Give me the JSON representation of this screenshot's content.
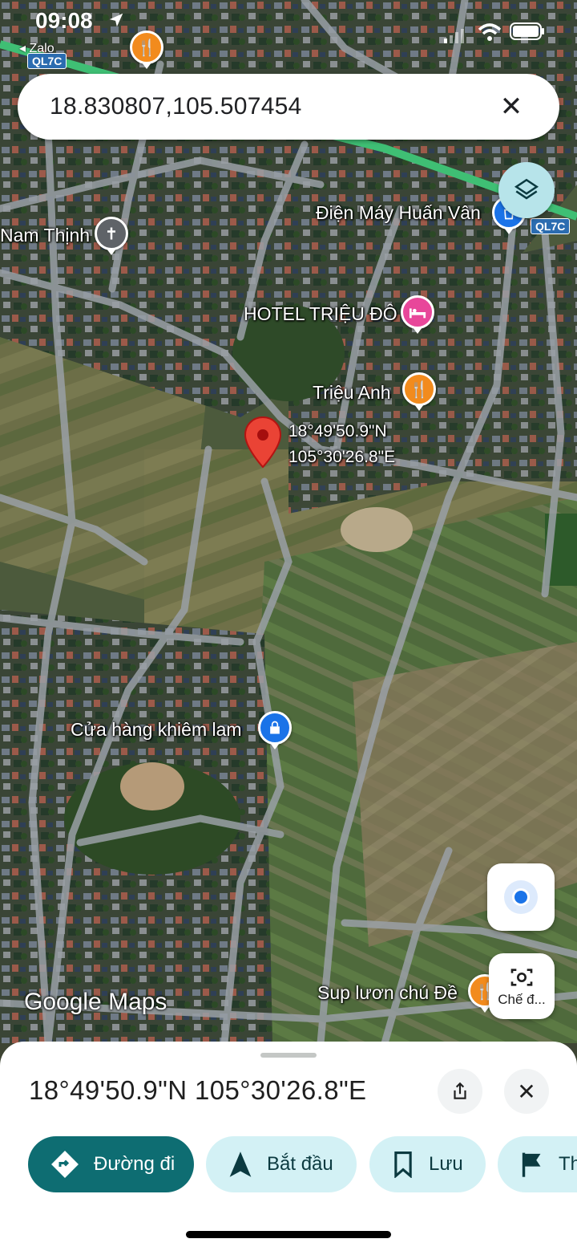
{
  "status_bar": {
    "time": "09:08",
    "back_app": "◂ Zalo"
  },
  "search": {
    "query": "18.830807,105.507454",
    "clear_icon": "close-icon"
  },
  "map": {
    "road_shields": [
      "QL7C",
      "QL7C"
    ],
    "pois": [
      {
        "name": "Điện Máy Huấn Vân",
        "icon": "shopping-icon",
        "color": "#1a73e8"
      },
      {
        "name": "Nam Thịnh",
        "icon": "church-icon",
        "color": "#5f6368"
      },
      {
        "name": "HOTEL TRIỆU ĐÔ",
        "icon": "hotel-icon",
        "color": "#e8479a"
      },
      {
        "name": "Triệu Anh",
        "icon": "restaurant-icon",
        "color": "#f28b1d"
      },
      {
        "name": "Cửa hàng khiêm lam",
        "icon": "shopping-icon",
        "color": "#1a73e8"
      },
      {
        "name": "Sup lươn chú Đề",
        "icon": "restaurant-icon",
        "color": "#f28b1d"
      }
    ],
    "pin": {
      "line1": "18°49'50.9\"N",
      "line2": "105°30'26.8\"E",
      "color": "#ea4335"
    },
    "attribution": "Google Maps",
    "lens_label": "Chế đ..."
  },
  "sheet": {
    "title": "18°49'50.9\"N 105°30'26.8\"E",
    "actions": [
      {
        "label": "Đường đi",
        "icon": "directions-icon",
        "primary": true
      },
      {
        "label": "Bắt đầu",
        "icon": "navigation-arrow-icon",
        "primary": false
      },
      {
        "label": "Lưu",
        "icon": "bookmark-icon",
        "primary": false
      },
      {
        "label": "Th",
        "icon": "flag-icon",
        "primary": false
      }
    ]
  }
}
